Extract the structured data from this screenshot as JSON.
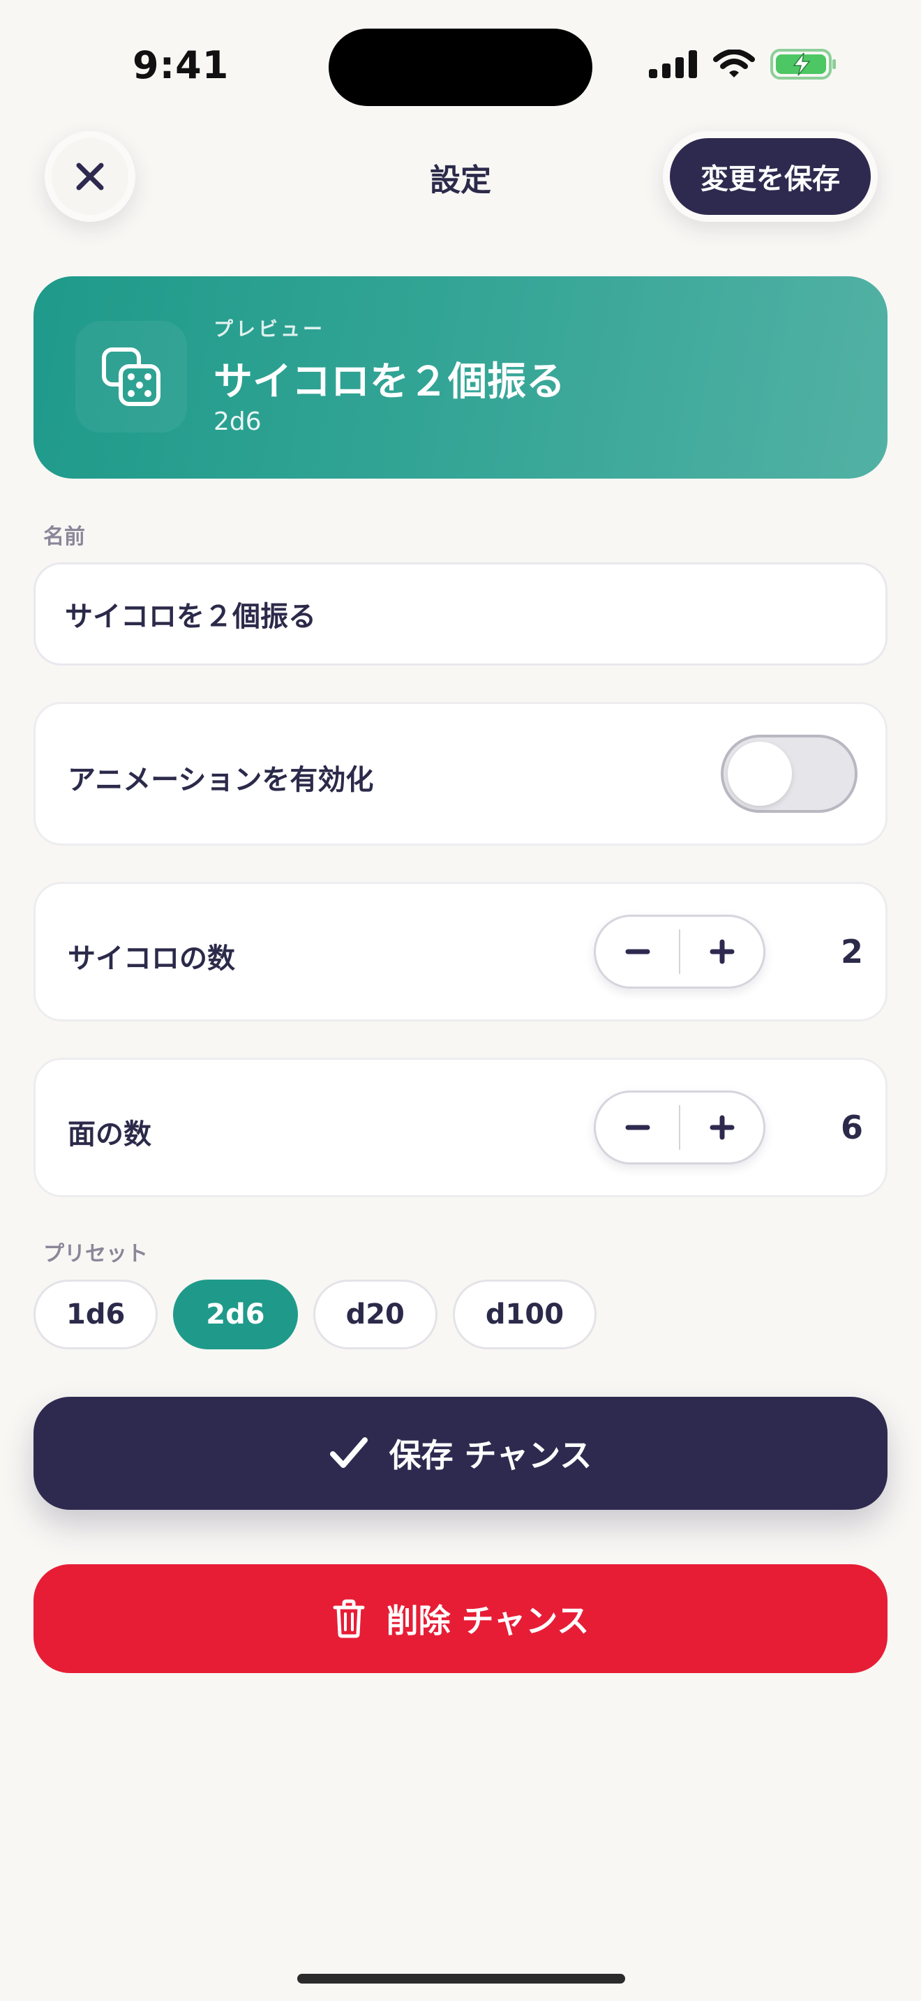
{
  "status_bar": {
    "time": "9:41"
  },
  "header": {
    "title": "設定",
    "save_label": "変更を保存"
  },
  "preview": {
    "kicker": "プレビュー",
    "title": "サイコロを２個振る",
    "subtitle": "2d6"
  },
  "name_section": {
    "label": "名前",
    "value": "サイコロを２個振る"
  },
  "animation": {
    "label": "アニメーションを有効化",
    "enabled": false
  },
  "dice_count": {
    "label": "サイコロの数",
    "value": "2",
    "minus": "−",
    "plus": "+"
  },
  "face_count": {
    "label": "面の数",
    "value": "6",
    "minus": "−",
    "plus": "+"
  },
  "presets": {
    "label": "プリセット",
    "items": [
      "1d6",
      "2d6",
      "d20",
      "d100"
    ],
    "selected": "2d6"
  },
  "actions": {
    "save_label": "保存 チャンス",
    "delete_label": "削除 チャンス"
  },
  "colors": {
    "accent": "#1f9a8a",
    "primary": "#2e2a4f",
    "danger": "#e71d36",
    "background": "#f8f7f4"
  },
  "icons": [
    "signal-icon",
    "wifi-icon",
    "battery-charging-icon",
    "close-icon",
    "dice-icon",
    "checkmark-icon",
    "trash-icon"
  ]
}
